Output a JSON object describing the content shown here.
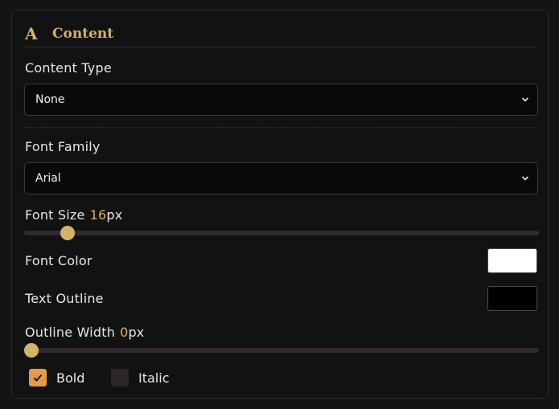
{
  "section": {
    "icon": "letter-a-icon",
    "icon_glyph": "A",
    "title": "Content"
  },
  "content_type": {
    "label": "Content Type",
    "selected": "None"
  },
  "font_family": {
    "label": "Font Family",
    "selected": "Arial"
  },
  "font_size": {
    "label": "Font Size",
    "value": "16",
    "unit": "px",
    "slider_fraction": 0.085
  },
  "font_color": {
    "label": "Font Color",
    "color": "#ffffff"
  },
  "text_outline": {
    "label": "Text Outline",
    "color": "#000000"
  },
  "outline_width": {
    "label": "Outline Width",
    "value": "0",
    "unit": "px",
    "slider_fraction": 0.0
  },
  "options": {
    "bold": {
      "label": "Bold",
      "checked": true
    },
    "italic": {
      "label": "Italic",
      "checked": false
    }
  },
  "colors": {
    "accent": "#d4b267",
    "checkbox_checked": "#e49a46"
  }
}
